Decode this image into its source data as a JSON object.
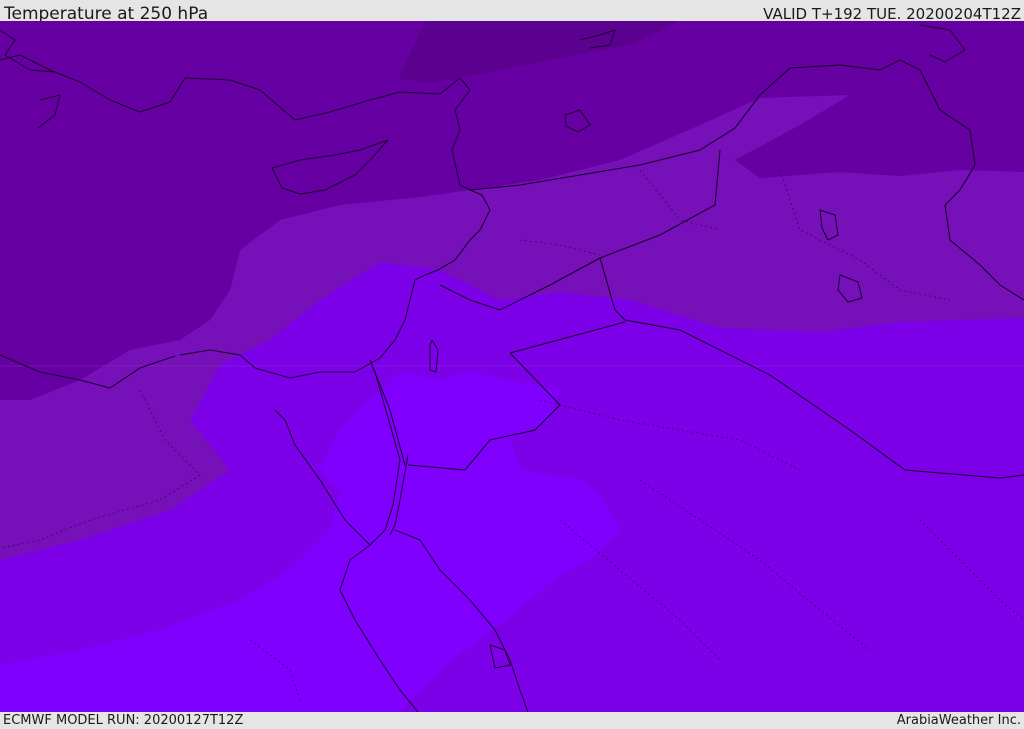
{
  "header": {
    "title": "Temperature at 250 hPa",
    "valid": "VALID T+192 TUE. 20200204T12Z"
  },
  "footer": {
    "model_run": "ECMWF MODEL RUN: 20200127T12Z",
    "credit": "ArabiaWeather Inc."
  },
  "map": {
    "field": "temperature",
    "level": "250 hPa",
    "region": "eastern-mediterranean-middle-east",
    "colors": {
      "coldest": "#5c0090",
      "cold": "#6600a2",
      "cool": "#7610b8",
      "mid": "#7c00e8",
      "warm": "#8000ff",
      "coastline": "#1a0030",
      "border_line": "#140020"
    }
  }
}
